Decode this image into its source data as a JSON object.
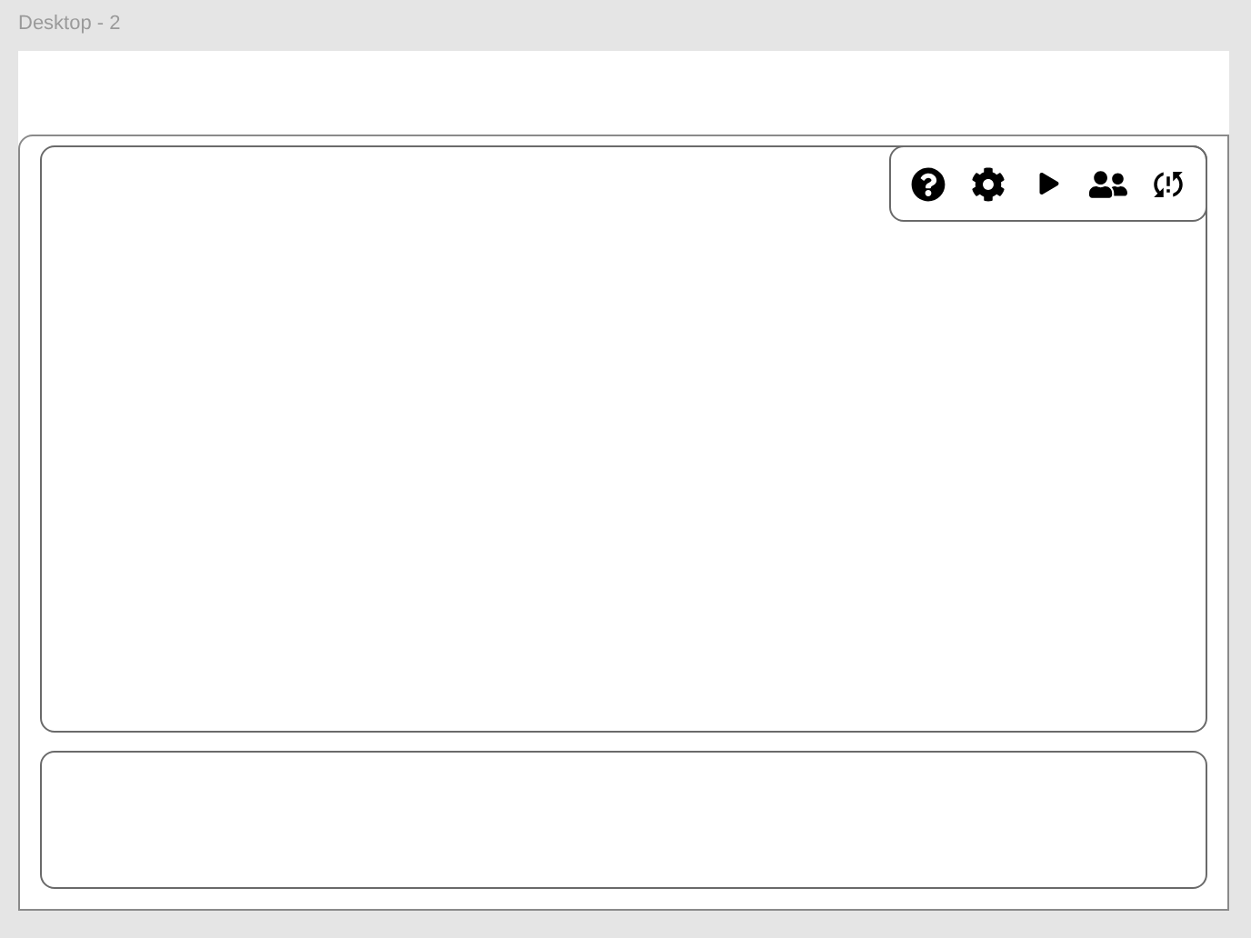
{
  "frame": {
    "title": "Desktop - 2"
  },
  "toolbar": {
    "buttons": [
      {
        "kind": "help"
      },
      {
        "kind": "settings"
      },
      {
        "kind": "play"
      },
      {
        "kind": "users"
      },
      {
        "kind": "sync"
      }
    ]
  }
}
